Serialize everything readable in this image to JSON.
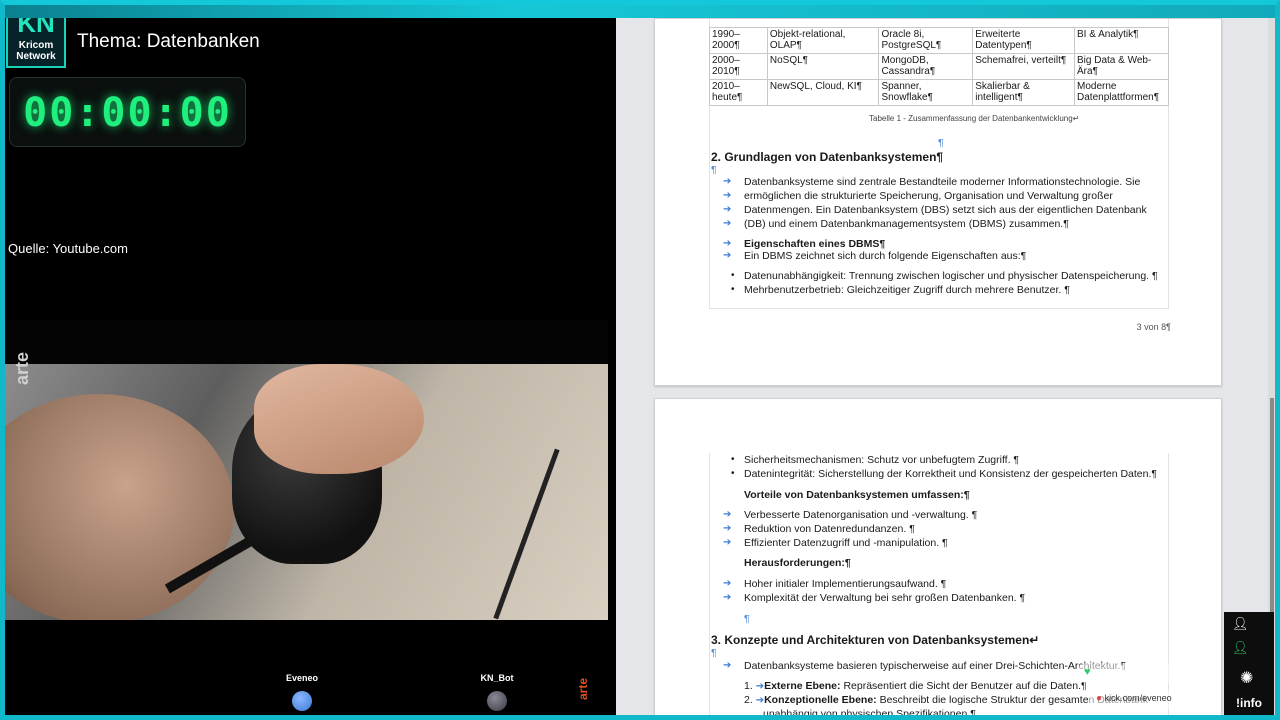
{
  "stream": {
    "logo": {
      "main": "KN",
      "line1": "Kricom",
      "line2": "Network"
    },
    "topic": "Thema: Datenbanken",
    "timer": "00:00:00",
    "source": "Quelle: Youtube.com",
    "video_watermark": "arte",
    "users": [
      {
        "name": "Eveneo",
        "color": "#3a7bd5"
      },
      {
        "name": "KN_Bot",
        "color": "#555560"
      }
    ],
    "corner_watermark": "arte"
  },
  "document": {
    "table": {
      "rows": [
        [
          "1990–2000¶",
          "Objekt-relational, OLAP¶",
          "Oracle 8i, PostgreSQL¶",
          "Erweiterte Datentypen¶",
          "BI & Analytik¶"
        ],
        [
          "2000–2010¶",
          "NoSQL¶",
          "MongoDB, Cassandra¶",
          "Schemafrei, verteilt¶",
          "Big Data & Web-Ära¶"
        ],
        [
          "2010–heute¶",
          "NewSQL, Cloud, KI¶",
          "Spanner, Snowflake¶",
          "Skalierbar & intelligent¶",
          "Moderne Datenplattformen¶"
        ]
      ],
      "caption": "Tabelle 1 - Zusammenfassung der Datenbankentwicklung↵"
    },
    "section2_heading": "2. Grundlagen von Datenbanksystemen¶",
    "intro_lines": [
      "Datenbanksysteme sind zentrale Bestandteile moderner Informationstechnologie. Sie",
      "ermöglichen die strukturierte Speicherung, Organisation und Verwaltung großer",
      "Datenmengen. Ein Datenbanksystem (DBS) setzt sich aus der eigentlichen Datenbank",
      "(DB) und einem Datenbankmanagementsystem (DBMS) zusammen.¶"
    ],
    "dbms_heading": "Eigenschaften eines DBMS¶",
    "dbms_intro": "Ein DBMS zeichnet sich durch folgende Eigenschaften aus:¶",
    "props_page1": [
      "Datenunabhängigkeit: Trennung zwischen logischer und physischer Datenspeicherung. ¶",
      "Mehrbenutzerbetrieb: Gleichzeitiger Zugriff durch mehrere Benutzer. ¶"
    ],
    "page_number": "3 von 8¶",
    "props_page2": [
      "Sicherheitsmechanismen: Schutz vor unbefugtem Zugriff. ¶",
      "Datenintegrität: Sicherstellung der Korrektheit und Konsistenz der gespeicherten Daten.¶"
    ],
    "advantages_heading": "Vorteile von Datenbanksystemen umfassen:¶",
    "advantages": [
      "Verbesserte Datenorganisation und -verwaltung. ¶",
      "Reduktion von Datenredundanzen. ¶",
      "Effizienter Datenzugriff und -manipulation. ¶"
    ],
    "challenges_heading": "Herausforderungen:¶",
    "challenges": [
      "Hoher initialer Implementierungsaufwand. ¶",
      "Komplexität der Verwaltung bei sehr großen Datenbanken. ¶"
    ],
    "section3_heading": "3. Konzepte und Architekturen von Datenbanksystemen↵",
    "section3_intro": "Datenbanksysteme basieren typischerweise auf einer Drei-Schichten-Architektur.¶",
    "layers": [
      {
        "num": "1.",
        "label": "Externe Ebene:",
        "text": " Repräsentiert die Sicht der Benutzer auf die Daten.¶"
      },
      {
        "num": "2.",
        "label": "Konzeptionelle Ebene:",
        "text": " Beschreibt die logische Struktur der gesamten Datenbank"
      }
    ],
    "layer2_cont": "unabhängig von physischen Spezifikationen.¶",
    "pilcrow": "¶"
  },
  "overlays": {
    "url_fragment": "kick.com/eveneo"
  },
  "side_widgets": {
    "info_label": "!info"
  }
}
